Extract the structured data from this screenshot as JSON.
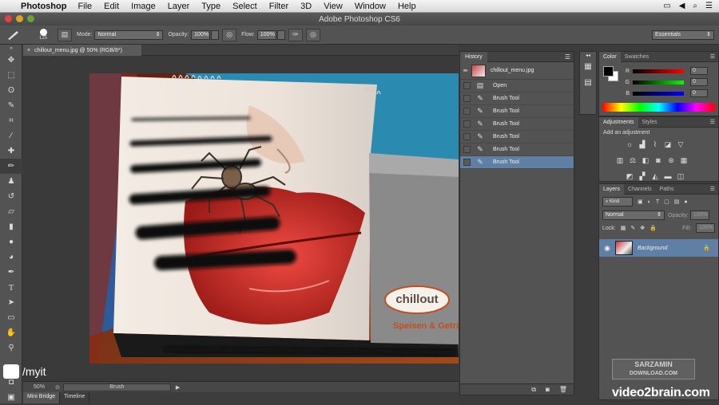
{
  "menubar": {
    "app": "Photoshop",
    "items": [
      "File",
      "Edit",
      "Image",
      "Layer",
      "Type",
      "Select",
      "Filter",
      "3D",
      "View",
      "Window",
      "Help"
    ]
  },
  "window": {
    "title": "Adobe Photoshop CS6"
  },
  "options": {
    "brush_size": "125",
    "mode_label": "Mode:",
    "mode_value": "Normal",
    "opacity_label": "Opacity:",
    "opacity_value": "100%",
    "flow_label": "Flow:",
    "flow_value": "100%",
    "workspace": "Essentials"
  },
  "document": {
    "tab_title": "chillout_menu.jpg @ 50% (RGB/8*)",
    "zoom": "50%",
    "status_info": "Brush"
  },
  "bottom_tabs": [
    "Mini Bridge",
    "Timeline"
  ],
  "history": {
    "title": "History",
    "snapshot": "chillout_menu.jpg",
    "items": [
      {
        "label": "Open",
        "icon": "document-icon",
        "selected": false
      },
      {
        "label": "Brush Tool",
        "icon": "brush-icon",
        "selected": false
      },
      {
        "label": "Brush Tool",
        "icon": "brush-icon",
        "selected": false
      },
      {
        "label": "Brush Tool",
        "icon": "brush-icon",
        "selected": false
      },
      {
        "label": "Brush Tool",
        "icon": "brush-icon",
        "selected": false
      },
      {
        "label": "Brush Tool",
        "icon": "brush-icon",
        "selected": false
      },
      {
        "label": "Brush Tool",
        "icon": "brush-icon",
        "selected": true
      }
    ]
  },
  "color_panel": {
    "tabs": [
      "Color",
      "Swatches"
    ],
    "channels": [
      {
        "label": "R",
        "value": "0"
      },
      {
        "label": "G",
        "value": "0"
      },
      {
        "label": "B",
        "value": "0"
      }
    ]
  },
  "adjustments_panel": {
    "tabs": [
      "Adjustments",
      "Styles"
    ],
    "heading": "Add an adjustment"
  },
  "layers_panel": {
    "tabs": [
      "Layers",
      "Channels",
      "Paths"
    ],
    "kind_label": "Kind",
    "blend_mode": "Normal",
    "opacity_label": "Opacity:",
    "opacity_value": "100%",
    "lock_label": "Lock:",
    "fill_label": "Fill:",
    "fill_value": "100%",
    "layer_name": "Background"
  },
  "photo": {
    "logo_text": "chillout",
    "subtitle": "Speisen & Getränke"
  },
  "watermarks": {
    "myit": "/myit",
    "video2brain": "video2brain.com",
    "sarzamin_line1": "SARZAMIN",
    "sarzamin_line2": "DOWNLOAD.COM"
  },
  "colors": {
    "selection": "#5f7fa4",
    "panel": "#535353",
    "lip_red": "#d42a2a"
  }
}
